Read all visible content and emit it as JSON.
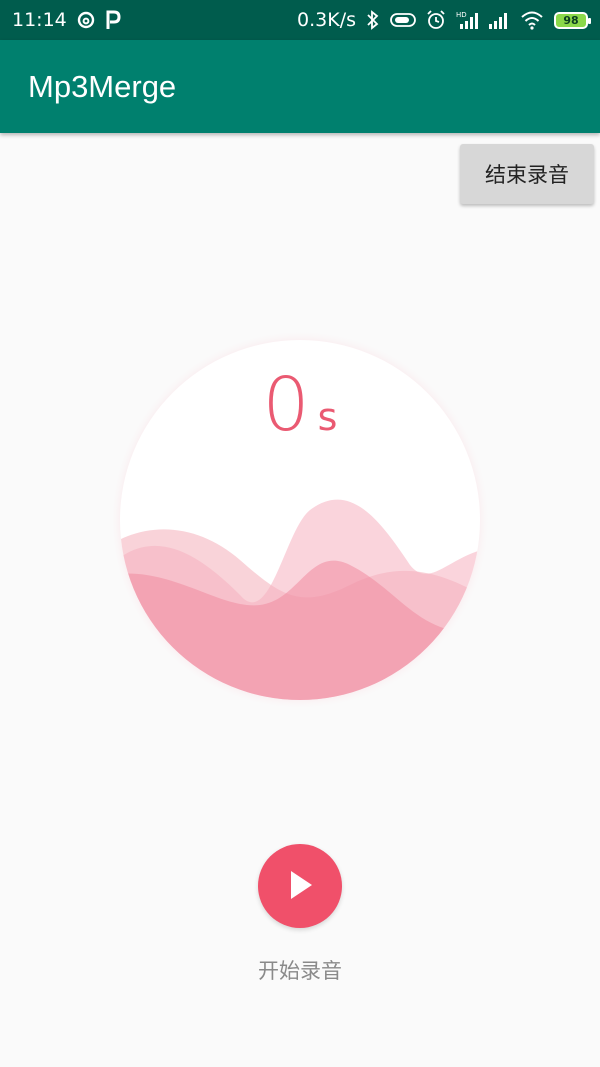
{
  "status_bar": {
    "time": "11:14",
    "network_speed": "0.3K/s",
    "battery": "98",
    "icons": [
      "netease-music-icon",
      "p-app-icon",
      "bluetooth-icon",
      "toggle-icon",
      "alarm-icon",
      "hd-signal-icon",
      "signal-icon",
      "wifi-icon",
      "battery-icon"
    ]
  },
  "app_bar": {
    "title": "Mp3Merge"
  },
  "recorder": {
    "stop_label": "结束录音",
    "timer_value": "0",
    "timer_unit": "s",
    "start_label": "开始录音"
  },
  "colors": {
    "status_bar": "#005c4d",
    "app_bar": "#00806e",
    "accent": "#f0506a",
    "timer": "#ea5a72"
  }
}
